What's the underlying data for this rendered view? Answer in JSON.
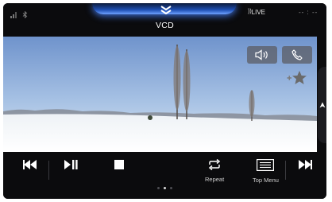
{
  "status_bar": {
    "icons": [
      "phone-signal-icon",
      "bluetooth-icon"
    ],
    "source_title": "VCD",
    "live_label": "LIVE",
    "live_icon": "radio-wave-icon",
    "clock": "-- : --"
  },
  "overlay": {
    "volume_button_icon": "speaker-volume-icon",
    "phone_button_icon": "phone-icon",
    "favorite_icon": "add-favorite-star-icon",
    "favorite_prefix": "+"
  },
  "side_tab": {
    "icon": "chevron-up-icon"
  },
  "controls": {
    "previous_icon": "skip-previous-icon",
    "play_pause_icon": "play-pause-icon",
    "stop_icon": "stop-icon",
    "repeat_label": "Repeat",
    "top_menu_label": "Top Menu",
    "next_icon": "skip-next-icon"
  },
  "pagination": {
    "pages": 3,
    "active": 1
  },
  "colors": {
    "background": "#0b0b0d",
    "accent_glow": "#3a7bff",
    "icon_white": "#ffffff",
    "label_gray": "#cfcfcf"
  }
}
